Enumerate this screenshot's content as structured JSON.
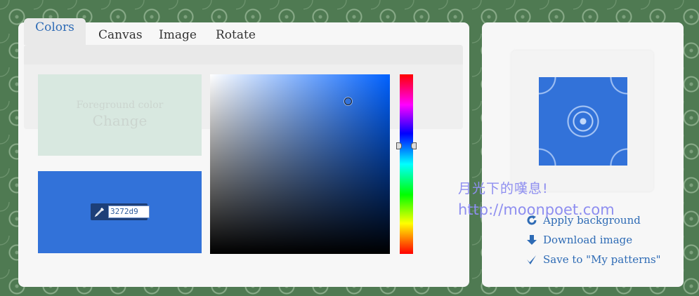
{
  "tabs": [
    {
      "label": "Colors",
      "active": true
    },
    {
      "label": "Canvas",
      "active": false
    },
    {
      "label": "Image",
      "active": false
    },
    {
      "label": "Rotate",
      "active": false
    }
  ],
  "foreground": {
    "label": "Foreground color",
    "action": "Change",
    "color": "#d8e8e0"
  },
  "background": {
    "hex": "3272d9",
    "color": "#3272d9"
  },
  "picker": {
    "hue_color": "#0061ff"
  },
  "actions": [
    {
      "label": "Apply background",
      "icon": "refresh-icon"
    },
    {
      "label": "Download image",
      "icon": "download-arrow-icon"
    },
    {
      "label": "Save to \"My patterns\"",
      "icon": "checkmark-icon"
    }
  ],
  "watermark": {
    "line1": "月光下的嘆息!",
    "line2": "http://moonpoet.com"
  },
  "colors": {
    "accent": "#2e6bb5",
    "page_bg": "#4f7a52",
    "watermark": "#8e8ef0"
  }
}
